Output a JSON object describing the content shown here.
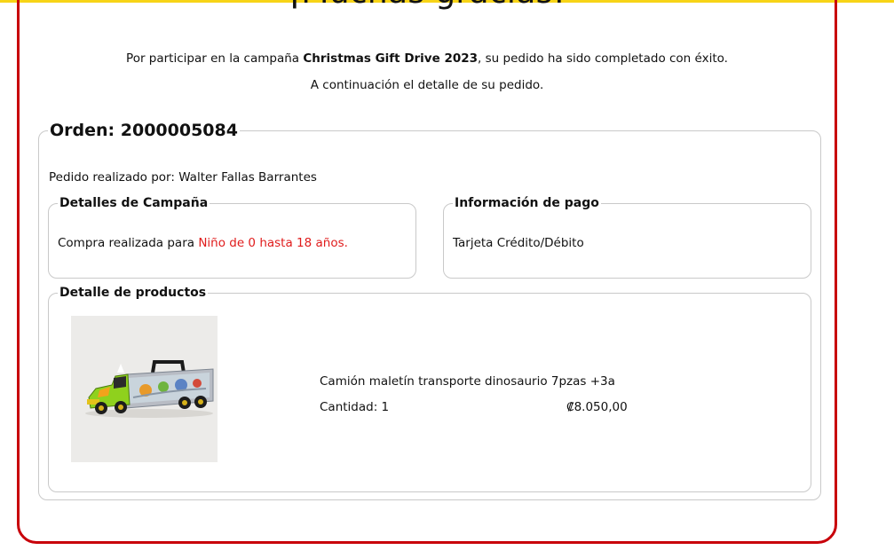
{
  "header": {
    "title": "¡Muchas gracias!",
    "intro_prefix": "Por participar en la campaña ",
    "campaign_name": "Christmas Gift Drive 2023",
    "intro_suffix": ", su pedido ha sido completado con éxito.",
    "intro_line2": "A continuación el detalle de su pedido."
  },
  "order": {
    "legend": "Orden: 2000005084",
    "placed_by": "Pedido realizado por: Walter Fallas Barrantes"
  },
  "campaign_details": {
    "legend": "Detalles de Campaña",
    "text_prefix": "Compra realizada para ",
    "target": "Niño de 0 hasta 18 años."
  },
  "payment": {
    "legend": "Información de pago",
    "method": "Tarjeta Crédito/Débito"
  },
  "products": {
    "legend": "Detalle de productos",
    "items": [
      {
        "name": "Camión maletín transporte dinosaurio 7pzas +3a",
        "quantity_label": "Cantidad: 1",
        "price": "₡8.050,00",
        "image": "toy-truck-dinosaur-carrier-image"
      }
    ]
  },
  "colors": {
    "accent_red": "#c8000a",
    "highlight_red": "#e01c1c",
    "top_line": "#f7d417"
  }
}
